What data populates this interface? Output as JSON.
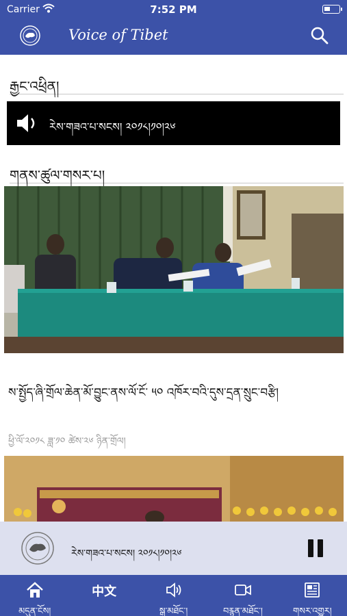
{
  "status_bar": {
    "carrier": "Carrier",
    "time": "7:52 PM"
  },
  "nav": {
    "title": "Voice of Tibet"
  },
  "live_section": {
    "heading": "རྒྱང་འཕྲིན།"
  },
  "audio_bar": {
    "label": "རེས་གཟའ་པ་སངས། ༢༠༡༨།༡༠།༢༦"
  },
  "news_section": {
    "heading": "གནས་ཚུལ་གསར་པ།"
  },
  "article": {
    "title": "ས་སྤྱོད་ཞི་གྲོལ་ཆེན་མོ་བྱུང་ནས་ལོ་ངོ་ ༥༠ འཁོར་བའི་དུས་དྲན་སྲུང་བརྩི།",
    "date": "ཕྱི་ལོ་༢༠༡༨ ཟླ་༡༠ ཚེས་༢༦ ཉིན་གྲོལ།"
  },
  "player": {
    "label": "རེས་གཟའ་པ་སངས། ༢༠༡༨།༡༠།༢༦"
  },
  "tabs": [
    {
      "label": "མདུན་ངོས།",
      "icon": "home-icon"
    },
    {
      "label": "中文",
      "icon": ""
    },
    {
      "label": "སྒྲ་མཐོང་།",
      "icon": "speaker-icon"
    },
    {
      "label": "བརྙན་མཐོང་།",
      "icon": "video-icon"
    },
    {
      "label": "གསར་འགྱུར།",
      "icon": "newspaper-icon"
    }
  ],
  "colors": {
    "brand_blue": "#3c52a8",
    "player_bg": "#dde0ef",
    "audio_bar_bg": "#000000"
  }
}
